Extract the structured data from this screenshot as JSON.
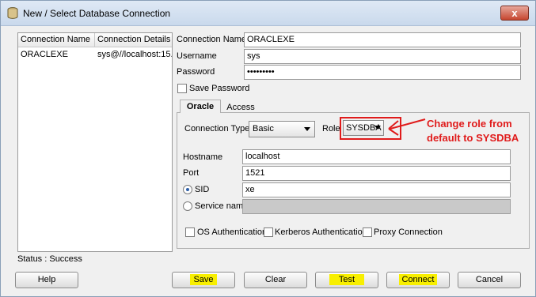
{
  "window": {
    "title": "New / Select Database Connection",
    "close_glyph": "x"
  },
  "connections": {
    "columns": [
      "Connection Name",
      "Connection Details"
    ],
    "rows": [
      {
        "name": "ORACLEXE",
        "details": "sys@//localhost:15..."
      }
    ]
  },
  "form": {
    "connection_name_label": "Connection Name",
    "connection_name_value": "ORACLEXE",
    "username_label": "Username",
    "username_value": "sys",
    "password_label": "Password",
    "password_value": "•••••••••",
    "save_password_label": "Save Password"
  },
  "tabs": [
    {
      "label": "Oracle"
    },
    {
      "label": "Access"
    }
  ],
  "oracle": {
    "connection_type_label": "Connection Type",
    "connection_type_value": "Basic",
    "role_label": "Role",
    "role_value": "SYSDBA",
    "hostname_label": "Hostname",
    "hostname_value": "localhost",
    "port_label": "Port",
    "port_value": "1521",
    "sid_label": "SID",
    "sid_value": "xe",
    "service_name_label": "Service name",
    "os_auth_label": "OS Authentication",
    "kerberos_label": "Kerberos Authentication",
    "proxy_label": "Proxy Connection"
  },
  "status": "Status : Success",
  "buttons": {
    "help": "Help",
    "save": "Save",
    "clear": "Clear",
    "test": "Test",
    "connect": "Connect",
    "cancel": "Cancel"
  },
  "annotation": {
    "line1": "Change role from",
    "line2": "default to SYSDBA"
  },
  "colors": {
    "annotation": "#e01b1b",
    "highlight": "#f8ef00"
  }
}
